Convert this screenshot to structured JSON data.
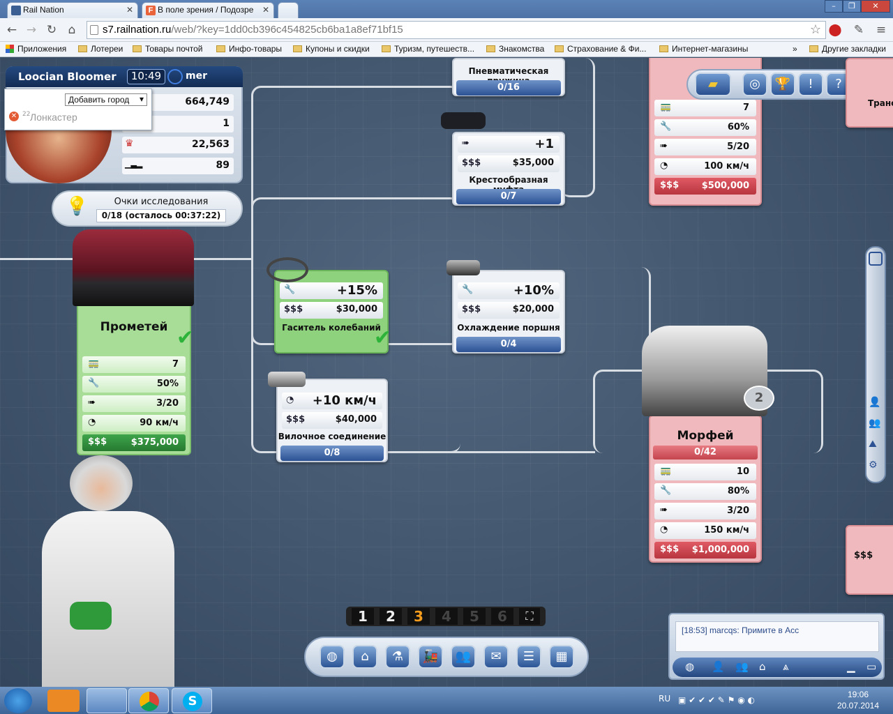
{
  "browser": {
    "tabs": [
      {
        "title": "Rail Nation"
      },
      {
        "title": "В поле зрения / Подозре"
      }
    ],
    "url_host": "s7.railnation.ru",
    "url_rest": "/web/?key=1dd0cb396c454825cb6ba1a8ef71bf15",
    "bookmarks": [
      "Приложения",
      "Лотереи",
      "Товары почтой",
      "Инфо-товары",
      "Купоны и скидки",
      "Туризм, путешеств...",
      "Знакомства",
      "Страхование & Фи...",
      "Интернет-магазины"
    ],
    "bookmarks_more": "»",
    "other_bookmarks": "Другие закладки"
  },
  "player": {
    "name": "Loocian Bloomer",
    "clock": "10:49",
    "name_fragment": "mer",
    "money": "664,749",
    "stat2": "1",
    "prestige": "22,563",
    "rank": "89",
    "add_city": "Добавить город",
    "city_prefix": "22",
    "city": "Лонкастер"
  },
  "research": {
    "title": "Очки исследования",
    "value": "0/18 (осталось 00:37:22)"
  },
  "locos": {
    "prometheus": {
      "name": "Прометей",
      "capacity": "7",
      "reliability": "50%",
      "acceleration": "3/20",
      "speed": "90 км/ч",
      "price": "$375,000"
    },
    "morpheus": {
      "name": "Морфей",
      "progress": "0/42",
      "capacity": "10",
      "reliability": "80%",
      "acceleration": "3/20",
      "speed": "150 км/ч",
      "price": "$1,000,000"
    },
    "top_right": {
      "capacity": "7",
      "reliability": "60%",
      "acceleration": "5/20",
      "speed": "100 км/ч",
      "price": "$500,000"
    }
  },
  "upgrades": {
    "spring": {
      "name": "Пневматическая пружина",
      "progress": "0/16"
    },
    "coupling": {
      "bonus": "+1",
      "price": "$35,000",
      "name": "Крестообразная муфта",
      "progress": "0/7"
    },
    "damper": {
      "bonus": "+15%",
      "price": "$30,000",
      "name": "Гаситель колебаний"
    },
    "piston": {
      "bonus": "+10%",
      "price": "$20,000",
      "name": "Охлаждение поршня",
      "progress": "0/4"
    },
    "fork": {
      "bonus": "+10 км/ч",
      "price": "$40,000",
      "name": "Вилочное соединение",
      "progress": "0/8"
    }
  },
  "labels": {
    "money_sign": "$$$",
    "trans": "Транс"
  },
  "eras": [
    "1",
    "2",
    "3",
    "4",
    "5",
    "6"
  ],
  "active_era": "3",
  "chat": {
    "message": "[18:53] marcqs: Примите в Acc"
  },
  "taskbar": {
    "lang": "RU",
    "time": "19:06",
    "date": "20.07.2014"
  },
  "colors": {
    "accent": "#2c5294",
    "research_green": "#8fd27d",
    "locked_pink": "#f0b9bd"
  }
}
